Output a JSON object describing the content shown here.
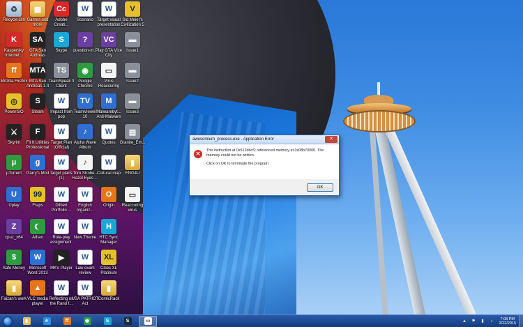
{
  "desktop": {
    "icons": [
      {
        "label": "Recycle Bin",
        "glyph": "♻",
        "style": "g-bin"
      },
      {
        "label": "Games and more",
        "glyph": "▦",
        "style": "g-folder"
      },
      {
        "label": "Adobe Creati...",
        "glyph": "Cc",
        "style": "g-red"
      },
      {
        "label": "Scenario",
        "glyph": "W",
        "style": "g-doc"
      },
      {
        "label": "Target visual presentation",
        "glyph": "W",
        "style": "g-doc"
      },
      {
        "label": "Sid Meier's Civilization 5",
        "glyph": "V",
        "style": "g-yellow"
      },
      {
        "label": "Kaspersky Internet...",
        "glyph": "K",
        "style": "g-red"
      },
      {
        "label": "GTA San Andreas",
        "glyph": "SA",
        "style": "g-dark"
      },
      {
        "label": "Skype",
        "glyph": "S",
        "style": "g-cyan"
      },
      {
        "label": "question-m...",
        "glyph": "?",
        "style": "g-purple"
      },
      {
        "label": "Play GTA Vice City",
        "glyph": "VC",
        "style": "g-purple"
      },
      {
        "label": "Issue1",
        "glyph": "▬",
        "style": "g-gray"
      },
      {
        "label": "Mozilla Firefox",
        "glyph": "ff",
        "style": "g-orange"
      },
      {
        "label": "MTA San Andreas 1.4",
        "glyph": "MTA",
        "style": "g-dark"
      },
      {
        "label": "TeamSpeak 3 Client",
        "glyph": "TS",
        "style": "g-gray"
      },
      {
        "label": "Google Chrome",
        "glyph": "◉",
        "style": "g-green"
      },
      {
        "label": "Virus Reaccuring",
        "glyph": "▭",
        "style": "g-white"
      },
      {
        "label": "Issue2",
        "glyph": "▬",
        "style": "g-gray"
      },
      {
        "label": "PowerISO",
        "glyph": "◎",
        "style": "g-yellow"
      },
      {
        "label": "Steam",
        "glyph": "S",
        "style": "g-dark"
      },
      {
        "label": "Impact from pop",
        "glyph": "W",
        "style": "g-doc"
      },
      {
        "label": "TeamViewer 10",
        "glyph": "TV",
        "style": "g-blue"
      },
      {
        "label": "Malwarebyt... Anti-Malware",
        "glyph": "M",
        "style": "g-blue"
      },
      {
        "label": "Issue3",
        "glyph": "▬",
        "style": "g-gray"
      },
      {
        "label": "Skyrim",
        "glyph": "⚔",
        "style": "g-dark"
      },
      {
        "label": "Fit It Utilities Professional",
        "glyph": "F",
        "style": "g-dark"
      },
      {
        "label": "Target Plan (Official)",
        "glyph": "W",
        "style": "g-doc"
      },
      {
        "label": "Alpha Wave Album",
        "glyph": "♪",
        "style": "g-blue"
      },
      {
        "label": "Quotes",
        "glyph": "W",
        "style": "g-doc"
      },
      {
        "label": "Granite_Em...",
        "glyph": "▤",
        "style": "g-gray"
      },
      {
        "label": "µTorrent",
        "glyph": "µ",
        "style": "g-green"
      },
      {
        "label": "Garry's Mod",
        "glyph": "g",
        "style": "g-blue"
      },
      {
        "label": "target plans (1)",
        "glyph": "W",
        "style": "g-doc"
      },
      {
        "label": "Tom Strobe - Hazel Eyes ...",
        "glyph": "♪",
        "style": "g-white"
      },
      {
        "label": "Cultural map",
        "glyph": "W",
        "style": "g-doc"
      },
      {
        "label": "ENG4U",
        "glyph": "▮",
        "style": "g-folder"
      },
      {
        "label": "Uplay",
        "glyph": "U",
        "style": "g-blue"
      },
      {
        "label": "Fraps",
        "glyph": "99",
        "style": "g-yellow"
      },
      {
        "label": "Dilbert Portfolio ...",
        "glyph": "W",
        "style": "g-doc"
      },
      {
        "label": "English organiz...",
        "glyph": "W",
        "style": "g-doc"
      },
      {
        "label": "Origin",
        "glyph": "O",
        "style": "g-orange"
      },
      {
        "label": "Reaccuring virus",
        "glyph": "▭",
        "style": "g-white"
      },
      {
        "label": "cpuz_x64",
        "glyph": "Z",
        "style": "g-purple"
      },
      {
        "label": "Athan",
        "glyph": "☾",
        "style": "g-green"
      },
      {
        "label": "Role-play assignment.",
        "glyph": "W",
        "style": "g-doc"
      },
      {
        "label": "New Theme",
        "glyph": "W",
        "style": "g-doc"
      },
      {
        "label": "HTC Sync Manager",
        "glyph": "H",
        "style": "g-cyan"
      },
      {
        "label": "",
        "glyph": "",
        "style": ""
      },
      {
        "label": "Safe Money",
        "glyph": "$",
        "style": "g-green"
      },
      {
        "label": "Microsoft Word 2013",
        "glyph": "W",
        "style": "g-blue"
      },
      {
        "label": "MKV Player",
        "glyph": "▶",
        "style": "g-dark"
      },
      {
        "label": "Law exam review",
        "glyph": "W",
        "style": "g-doc"
      },
      {
        "label": "Cities XL Platinum",
        "glyph": "XL",
        "style": "g-yellow"
      },
      {
        "label": "",
        "glyph": "",
        "style": ""
      },
      {
        "label": "Faizan's work",
        "glyph": "▮",
        "style": "g-folder"
      },
      {
        "label": "VLC media player",
        "glyph": "▲",
        "style": "g-orange"
      },
      {
        "label": "Reflecting on the Rand f...",
        "glyph": "W",
        "style": "g-doc"
      },
      {
        "label": "USA PATRIOT Act",
        "glyph": "W",
        "style": "g-doc"
      },
      {
        "label": "ComicRack",
        "glyph": "▮",
        "style": "g-folder"
      },
      {
        "label": "",
        "glyph": "",
        "style": ""
      }
    ]
  },
  "dialog": {
    "title": "awesomium_process.exe - Application Error",
    "close_glyph": "✕",
    "error_glyph": "✕",
    "message_line1": "The instruction at 0x512dbcf2 referenced memory at 0x08b70000. The memory could not be written.",
    "message_line2": "Click on OK to terminate the program",
    "ok_label": "OK"
  },
  "taskbar": {
    "items": [
      {
        "name": "explorer",
        "glyph": "▮",
        "color": "#e8c15a",
        "active": false
      },
      {
        "name": "internet-explorer",
        "glyph": "e",
        "color": "#2f8de0",
        "active": false
      },
      {
        "name": "firefox",
        "glyph": "ff",
        "color": "#e5761b",
        "active": false
      },
      {
        "name": "chrome",
        "glyph": "◉",
        "color": "#2e9b3e",
        "active": false
      },
      {
        "name": "skype",
        "glyph": "S",
        "color": "#1aa7d6",
        "active": false
      },
      {
        "name": "steam",
        "glyph": "S",
        "color": "#1c2a3a",
        "active": false
      },
      {
        "name": "app-window",
        "glyph": "▭",
        "color": "#ffffff",
        "active": true
      }
    ],
    "tray": {
      "chevron": "▲",
      "flag": "⚑",
      "network": "▮",
      "volume": "♪",
      "time": "7:08 PM",
      "date": "2/22/2015"
    }
  }
}
